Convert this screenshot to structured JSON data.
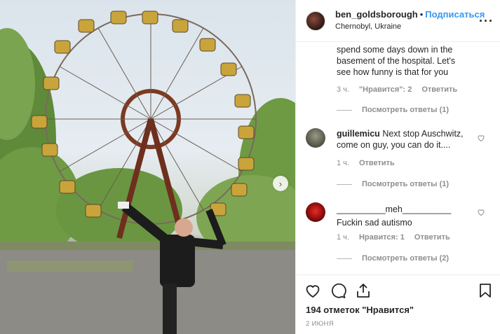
{
  "header": {
    "username": "ben_goldsborough",
    "separator": "•",
    "follow_label": "Подписаться",
    "location": "Chernobyl, Ukraine",
    "more_icon": "more-horizontal-icon"
  },
  "comments": [
    {
      "author": "",
      "text": "spend some days down in the basement of the hospital. Let's see how funny is that for you",
      "lines": [
        "spend some days down in the",
        "basement of the hospital. Let's",
        "see how funny is that for you"
      ],
      "time": "3 ч.",
      "likes_label": "\"Нравится\": 2",
      "reply_label": "Ответить",
      "view_replies": "Посмотреть ответы (1)"
    },
    {
      "author": "guillemicu",
      "text": "Next stop Auschwitz, come on guy, you can do it....",
      "line1_rest": "Next stop Auschwitz,",
      "line2": "come on guy, you can do it....",
      "time": "1 ч.",
      "reply_label": "Ответить",
      "view_replies": "Посмотреть ответы (1)"
    },
    {
      "author": "__________meh__________",
      "text": "Fuckin sad autismo",
      "time": "1 ч.",
      "likes_label": "Нравится: 1",
      "reply_label": "Ответить",
      "view_replies": "Посмотреть ответы (2)"
    }
  ],
  "footer": {
    "likes": "194 отметок \"Нравится\"",
    "date": "2 ИЮНЯ"
  },
  "colors": {
    "accent": "#3897f0",
    "muted": "#8e8e8e",
    "text": "#262626",
    "border": "#efefef"
  }
}
